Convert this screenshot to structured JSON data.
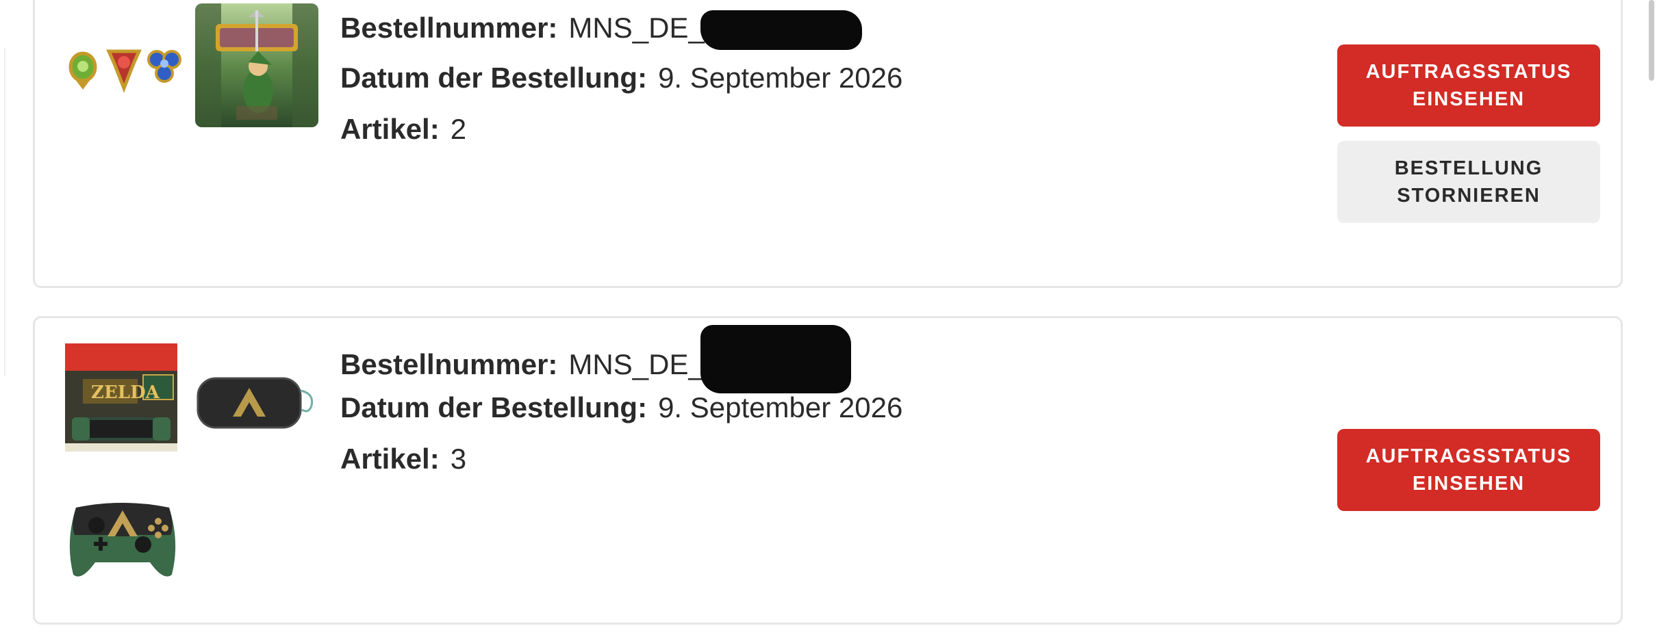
{
  "orders": [
    {
      "order_number_label": "Bestellnummer:",
      "order_number_value": "MNS_DE_",
      "order_date_label": "Datum der Bestellung:",
      "order_date_value": "9. September 2026",
      "items_label": "Artikel:",
      "items_value": "2",
      "products": [
        "spiritual-stones-image",
        "zelda-ocarina-of-time-cover"
      ],
      "buttons": {
        "status": "AUFTRAGSSTATUS EINSEHEN",
        "cancel": "BESTELLUNG STORNIEREN"
      }
    },
    {
      "order_number_label": "Bestellnummer:",
      "order_number_value": "MNS_DE_",
      "order_date_label": "Datum der Bestellung:",
      "order_date_value": "9. September 2026",
      "items_label": "Artikel:",
      "items_value": "3",
      "products": [
        "zelda-switch-oled-box",
        "triforce-carrying-case",
        "zelda-pro-controller"
      ],
      "buttons": {
        "status": "AUFTRAGSSTATUS EINSEHEN"
      }
    }
  ],
  "colors": {
    "primary_button": "#d32b25",
    "secondary_button": "#eeeeee",
    "card_border": "#e6e6e6"
  }
}
